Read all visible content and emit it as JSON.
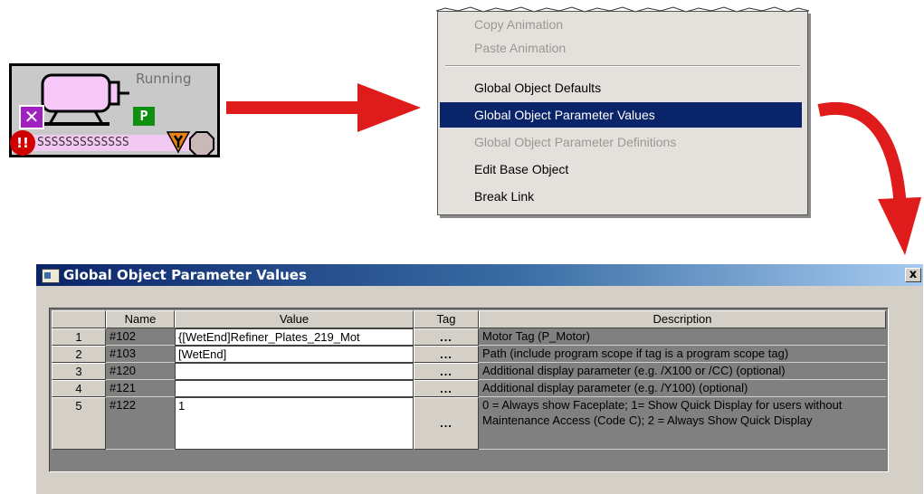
{
  "faceplate": {
    "status": "Running",
    "tag_text": "SSSSSSSSSSSSS",
    "p_badge": "P",
    "alarm_badge": "!!",
    "icons": [
      "motor-icon",
      "bypass-x-icon",
      "program-mode-icon",
      "alarm-icon",
      "maintenance-wrench-icon",
      "octagon-status-icon"
    ],
    "colors": {
      "motor": "#f7c8f7",
      "tagbar": "#f3c8f3",
      "alarm": "#d00000",
      "p": "#109010"
    }
  },
  "context_menu": {
    "items": [
      {
        "label": "Copy Animation",
        "disabled": true
      },
      {
        "label": "Paste Animation",
        "disabled": true
      },
      {
        "label": "Global Object Defaults",
        "disabled": false
      },
      {
        "label": "Global Object Parameter Values",
        "disabled": false,
        "selected": true
      },
      {
        "label": "Global Object Parameter Definitions",
        "disabled": true
      },
      {
        "label": "Edit Base Object",
        "disabled": false
      },
      {
        "label": "Break Link",
        "disabled": false
      }
    ],
    "selected_color": "#0a246a"
  },
  "dialog": {
    "title": "Global Object Parameter Values",
    "close_label": "x",
    "columns": {
      "name": "Name",
      "value": "Value",
      "tag": "Tag",
      "description": "Description"
    },
    "rows": [
      {
        "num": "1",
        "name": "#102",
        "value": "{[WetEnd]Refiner_Plates_219_Mot",
        "tag": "...",
        "description": "Motor Tag (P_Motor)"
      },
      {
        "num": "2",
        "name": "#103",
        "value": "[WetEnd]",
        "tag": "...",
        "description": "Path (include program scope if tag is a program scope tag)"
      },
      {
        "num": "3",
        "name": "#120",
        "value": "",
        "tag": "...",
        "description": "Additional display parameter (e.g. /X100 or /CC) (optional)"
      },
      {
        "num": "4",
        "name": "#121",
        "value": "",
        "tag": "...",
        "description": "Additional display parameter (e.g. /Y100) (optional)"
      },
      {
        "num": "5",
        "name": "#122",
        "value": "1",
        "tag": "...",
        "description": "0 = Always show Faceplate;  1= Show Quick Display for users without Maintenance Access (Code C); 2 = Always Show Quick Display"
      }
    ]
  },
  "arrows": {
    "color": "#e01b1b"
  }
}
